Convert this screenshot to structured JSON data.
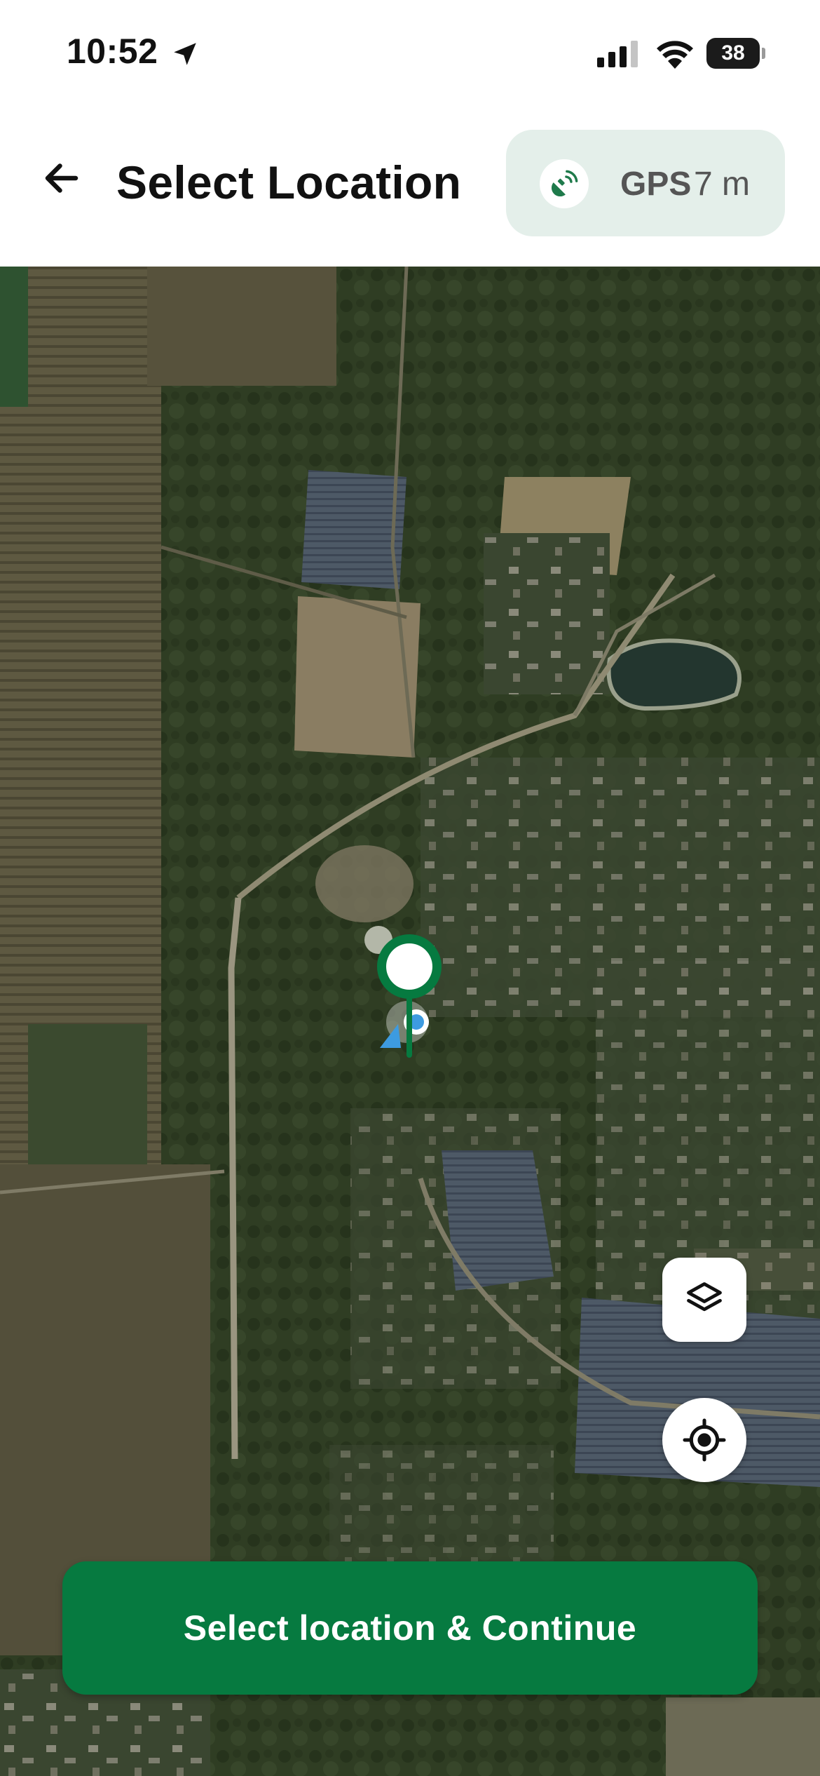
{
  "status_bar": {
    "time": "10:52",
    "battery_level": "38",
    "location_icon": "location-arrow-icon",
    "signal_icon": "cellular-signal-icon",
    "wifi_icon": "wifi-icon",
    "battery_icon": "battery-icon"
  },
  "header": {
    "title": "Select Location",
    "back_icon": "arrow-left-icon",
    "gps": {
      "label": "GPS",
      "accuracy": "7 m",
      "icon": "satellite-signal-icon"
    }
  },
  "map": {
    "type": "satellite",
    "controls": {
      "layers_icon": "layers-icon",
      "recenter_icon": "crosshair-icon"
    },
    "markers": {
      "selection_pin_icon": "map-pin-icon",
      "user_location_icon": "user-location-icon"
    }
  },
  "actions": {
    "continue_label": "Select location & Continue"
  },
  "colors": {
    "brand_green": "#067a40",
    "chip_background": "#e4efea",
    "user_location_blue": "#3d9be0"
  }
}
